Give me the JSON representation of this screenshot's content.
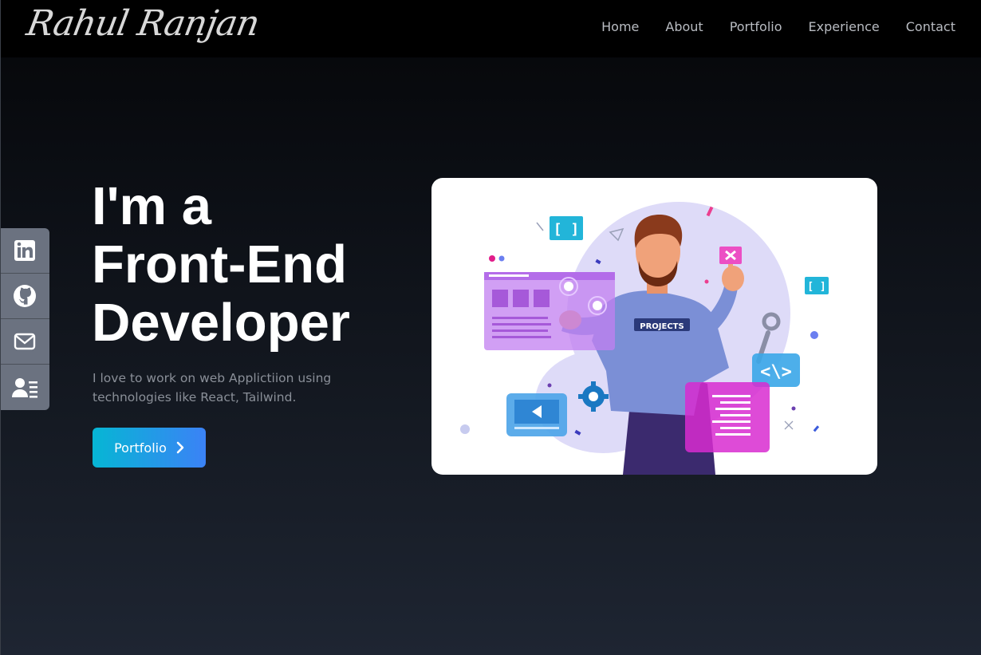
{
  "brand": {
    "name": "Rahul Ranjan"
  },
  "nav": {
    "items": [
      "Home",
      "About",
      "Portfolio",
      "Experience",
      "Contact"
    ]
  },
  "social": [
    {
      "name": "linkedin-icon"
    },
    {
      "name": "github-icon"
    },
    {
      "name": "mail-icon"
    },
    {
      "name": "resume-icon"
    }
  ],
  "hero": {
    "title_lines": [
      "I'm a",
      "Front-End",
      "Developer"
    ],
    "subtitle": "I love to work on web Applictiion using technologies like React, Tailwind.",
    "button_label": "Portfolio",
    "badge_text": "PROJECTS"
  },
  "colors": {
    "accent_start": "#06b6d4",
    "accent_end": "#3b82f6",
    "social_bg": "#6b7280"
  }
}
